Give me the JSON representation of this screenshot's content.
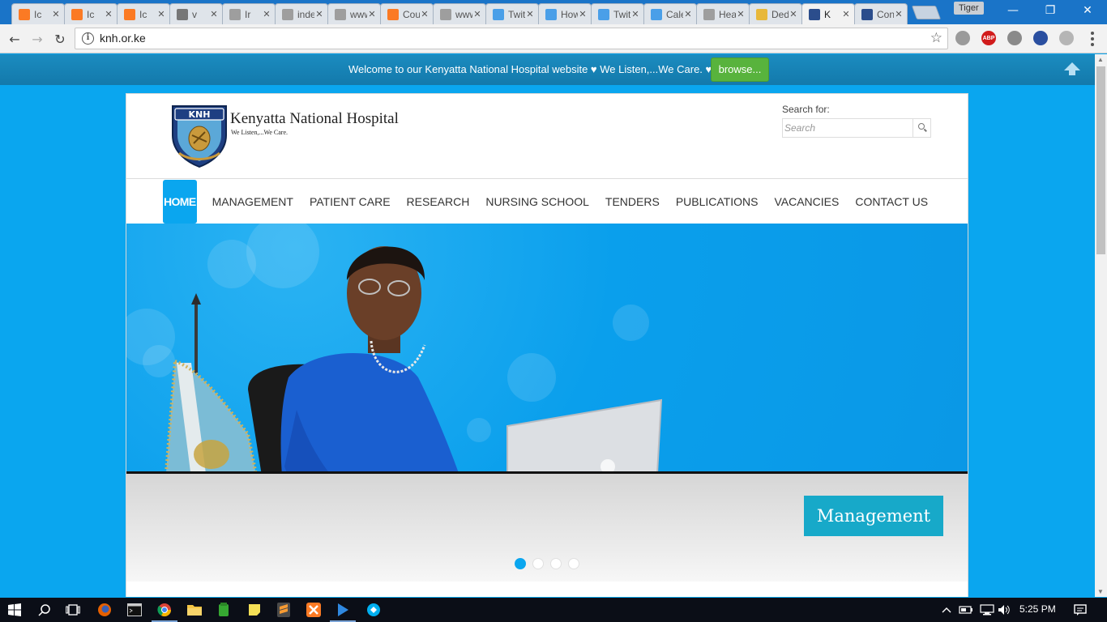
{
  "browser": {
    "tabs": [
      {
        "title": "Ic",
        "favicon": "xampp-icon",
        "color": "#fb7a24"
      },
      {
        "title": "Ic",
        "favicon": "xampp-icon",
        "color": "#fb7a24"
      },
      {
        "title": "Ic",
        "favicon": "xampp-icon",
        "color": "#fb7a24"
      },
      {
        "title": "v",
        "favicon": "generic-app-icon",
        "color": "#777777"
      },
      {
        "title": "Ir",
        "favicon": "page-icon",
        "color": "#9e9e9e"
      },
      {
        "title": "inde",
        "favicon": "page-icon",
        "color": "#9e9e9e"
      },
      {
        "title": "www",
        "favicon": "page-icon",
        "color": "#9e9e9e"
      },
      {
        "title": "Cour",
        "favicon": "xampp-icon",
        "color": "#fb7a24"
      },
      {
        "title": "www",
        "favicon": "page-icon",
        "color": "#9e9e9e"
      },
      {
        "title": "Twitt",
        "favicon": "twitter-icon",
        "color": "#4a9fe8"
      },
      {
        "title": "How",
        "favicon": "twitter-icon",
        "color": "#4a9fe8"
      },
      {
        "title": "Twitt",
        "favicon": "twitter-icon",
        "color": "#4a9fe8"
      },
      {
        "title": "Calel",
        "favicon": "twitter-icon",
        "color": "#4a9fe8"
      },
      {
        "title": "Heal",
        "favicon": "page-icon",
        "color": "#9e9e9e"
      },
      {
        "title": "Dedi",
        "favicon": "crest-icon",
        "color": "#e8b83a"
      },
      {
        "title": "K",
        "favicon": "knh-icon",
        "color": "#2b4d8c",
        "active": true
      },
      {
        "title": "Cont",
        "favicon": "knh-icon",
        "color": "#2b4d8c"
      }
    ],
    "profile_name": "Tiger",
    "url": "knh.or.ke",
    "window_controls": {
      "minimize": "—",
      "restore": "❐",
      "close": "✕"
    },
    "extensions": [
      {
        "name": "eye-extension-icon",
        "color": "#9a9a9a",
        "text": ""
      },
      {
        "name": "adblock-icon",
        "color": "#d11c1c",
        "text": "ABP"
      },
      {
        "name": "cloud-extension-icon",
        "color": "#8a8a8a",
        "text": ""
      },
      {
        "name": "globe-extension-icon",
        "color": "#2a4fa0",
        "text": ""
      },
      {
        "name": "pdf-extension-icon",
        "color": "#b5b5b5",
        "text": ""
      }
    ]
  },
  "page": {
    "welcome_text": "Welcome to our Kenyatta National Hospital website ♥ We Listen,...We Care. ♥",
    "browse_label": "browse...",
    "site_title": "Kenyatta National Hospital",
    "site_tagline": "We Listen,...We Care.",
    "logo_letters": "KNH",
    "search_label": "Search for:",
    "search_placeholder": "Search",
    "nav": [
      "HOME",
      "MANAGEMENT",
      "PATIENT CARE",
      "RESEARCH",
      "NURSING SCHOOL",
      "TENDERS",
      "PUBLICATIONS",
      "VACANCIES",
      "CONTACT US"
    ],
    "nav_active": 0,
    "slide_caption": "Management",
    "slide_count": 4,
    "slide_active": 0,
    "colors": {
      "accent": "#0aa6ef",
      "browse": "#58b33d",
      "caption": "#17a9c9"
    }
  },
  "taskbar": {
    "apps": [
      "windows-start-icon",
      "search-icon",
      "task-view-icon",
      "firefox-icon",
      "cmd-icon",
      "chrome-icon",
      "file-explorer-icon",
      "green-app-icon",
      "sticky-notes-icon",
      "sublime-icon",
      "xampp-icon",
      "media-player-icon",
      "skype-icon"
    ],
    "tray_icons": [
      "chevron-up-icon",
      "battery-icon",
      "network-icon",
      "volume-icon"
    ],
    "time": "5:25 PM"
  }
}
